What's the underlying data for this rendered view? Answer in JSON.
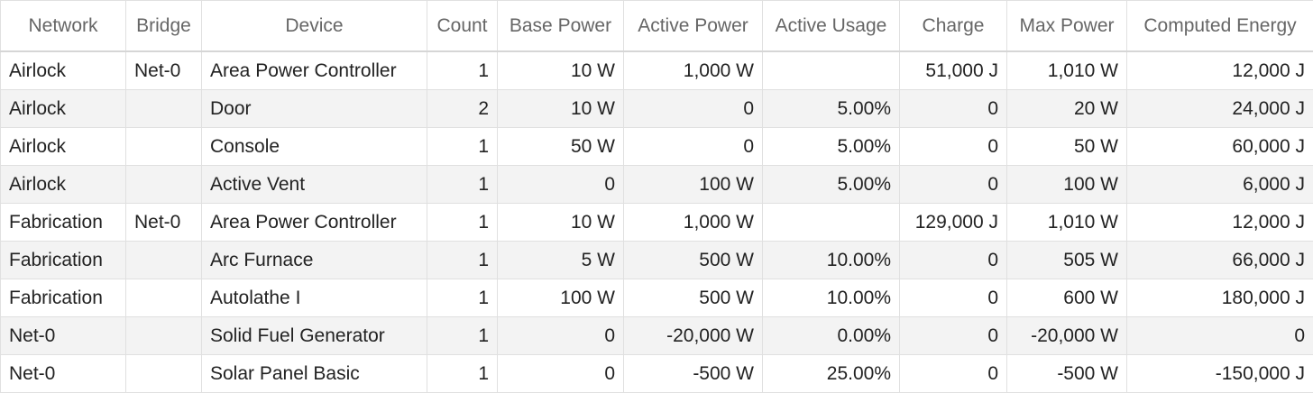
{
  "table": {
    "columns": [
      "Network",
      "Bridge",
      "Device",
      "Count",
      "Base Power",
      "Active Power",
      "Active Usage",
      "Charge",
      "Max Power",
      "Computed Energy"
    ],
    "rows": [
      [
        "Airlock",
        "Net-0",
        "Area Power Controller",
        "1",
        "10 W",
        "1,000 W",
        "",
        "51,000 J",
        "1,010 W",
        "12,000 J"
      ],
      [
        "Airlock",
        "",
        "Door",
        "2",
        "10 W",
        "0",
        "5.00%",
        "0",
        "20 W",
        "24,000 J"
      ],
      [
        "Airlock",
        "",
        "Console",
        "1",
        "50 W",
        "0",
        "5.00%",
        "0",
        "50 W",
        "60,000 J"
      ],
      [
        "Airlock",
        "",
        "Active Vent",
        "1",
        "0",
        "100 W",
        "5.00%",
        "0",
        "100 W",
        "6,000 J"
      ],
      [
        "Fabrication",
        "Net-0",
        "Area Power Controller",
        "1",
        "10 W",
        "1,000 W",
        "",
        "129,000 J",
        "1,010 W",
        "12,000 J"
      ],
      [
        "Fabrication",
        "",
        "Arc Furnace",
        "1",
        "5 W",
        "500 W",
        "10.00%",
        "0",
        "505 W",
        "66,000 J"
      ],
      [
        "Fabrication",
        "",
        "Autolathe I",
        "1",
        "100 W",
        "500 W",
        "10.00%",
        "0",
        "600 W",
        "180,000 J"
      ],
      [
        "Net-0",
        "",
        "Solid Fuel Generator",
        "1",
        "0",
        "-20,000 W",
        "0.00%",
        "0",
        "-20,000 W",
        "0"
      ],
      [
        "Net-0",
        "",
        "Solar Panel Basic",
        "1",
        "0",
        "-500 W",
        "25.00%",
        "0",
        "-500 W",
        "-150,000 J"
      ]
    ]
  }
}
